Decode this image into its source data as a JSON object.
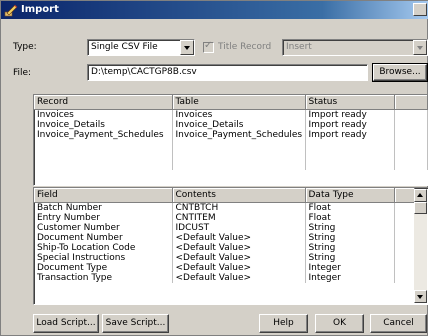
{
  "window": {
    "title": "Import"
  },
  "type_label": "Type:",
  "type_value": "Single CSV File",
  "title_record_label": "Title Record",
  "insert_value": "Insert",
  "file_label": "File:",
  "file_value": "D:\\temp\\CACTGP8B.csv",
  "browse_label": "Browse...",
  "records": {
    "headers": [
      "Record",
      "Table",
      "Status"
    ],
    "rows": [
      [
        "Invoices",
        "Invoices",
        "Import ready"
      ],
      [
        "Invoice_Details",
        "Invoice_Details",
        "Import ready"
      ],
      [
        "Invoice_Payment_Schedules",
        "Invoice_Payment_Schedules",
        "Import ready"
      ]
    ]
  },
  "fields": {
    "headers": [
      "Field",
      "Contents",
      "Data Type"
    ],
    "rows": [
      [
        "Batch Number",
        "CNTBTCH",
        "Float"
      ],
      [
        "Entry Number",
        "CNTITEM",
        "Float"
      ],
      [
        "Customer Number",
        "IDCUST",
        "String"
      ],
      [
        "Document Number",
        "<Default Value>",
        "String"
      ],
      [
        "Ship-To Location Code",
        "<Default Value>",
        "String"
      ],
      [
        "Special Instructions",
        "<Default Value>",
        "String"
      ],
      [
        "Document Type",
        "<Default Value>",
        "Integer"
      ],
      [
        "Transaction Type",
        "<Default Value>",
        "Integer"
      ]
    ]
  },
  "buttons": {
    "load_script": "Load Script...",
    "save_script": "Save Script...",
    "help": "Help",
    "ok": "OK",
    "cancel": "Cancel"
  },
  "colors": {
    "title_bar": "#0a246a",
    "face": "#d4d0c8"
  }
}
